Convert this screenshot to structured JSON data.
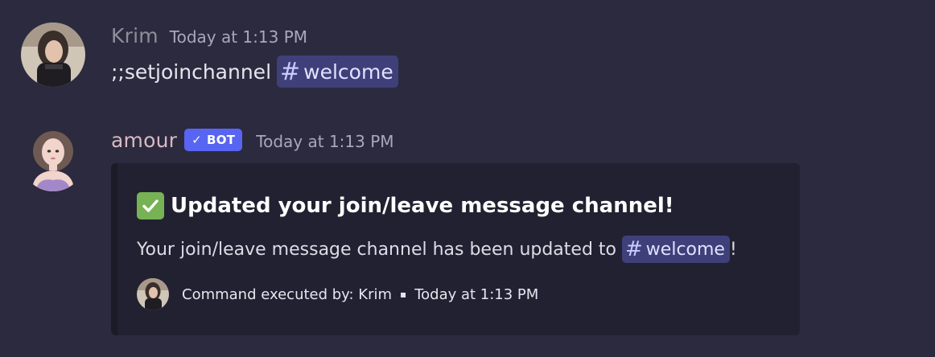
{
  "messages": [
    {
      "username": "Krim",
      "username_color": "#8e8e9a",
      "timestamp": "Today at 1:13 PM",
      "content_prefix": ";;setjoinchannel ",
      "mention": "welcome"
    },
    {
      "username": "amour",
      "username_color": "#d8b9c2",
      "bot_badge": "BOT",
      "timestamp": "Today at 1:13 PM",
      "embed": {
        "title": "Updated your join/leave message channel!",
        "description_prefix": "Your join/leave message channel has been updated to",
        "mention": "welcome",
        "description_suffix": "!",
        "footer_text": "Command executed by: Krim",
        "footer_separator": "▪",
        "footer_timestamp": "Today at 1:13 PM"
      }
    }
  ],
  "colors": {
    "background": "#2c2a3e",
    "embed_background": "#222131",
    "mention_background": "#3f407a",
    "bot_badge": "#5865f2",
    "check_green": "#77b255"
  },
  "icons": {
    "hash": "#",
    "check": "✓"
  }
}
